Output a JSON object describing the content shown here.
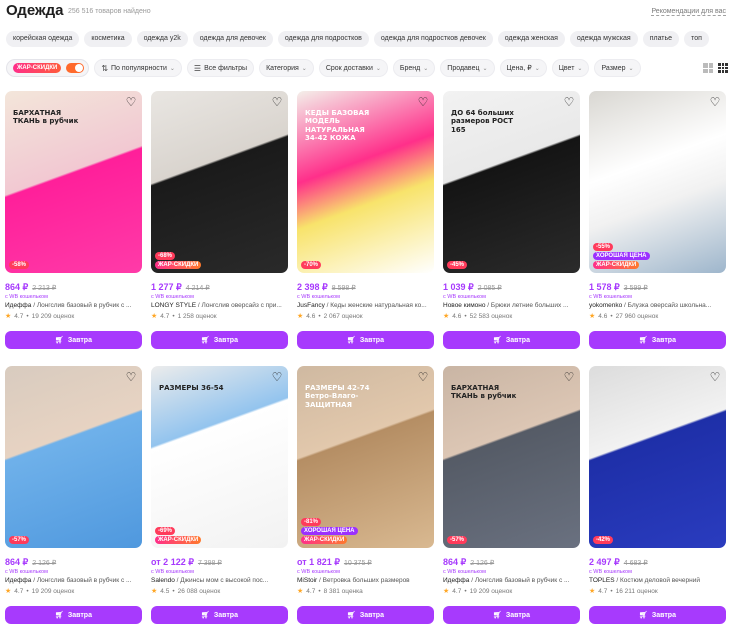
{
  "header": {
    "title": "Одежда",
    "count": "256 516 товаров найдено",
    "recs": "Рекомендации для вас"
  },
  "tags": [
    "корейская одежда",
    "косметика",
    "одежда y2k",
    "одежда для девочек",
    "одежда для подростков",
    "одежда для подростков девочек",
    "одежда женская",
    "одежда мужская",
    "платье",
    "топ"
  ],
  "filters": {
    "hot_label": "ЖАР-СКИДКИ",
    "sort": "По популярности",
    "all": "Все фильтры",
    "items": [
      "Категория",
      "Срок доставки",
      "Бренд",
      "Продавец",
      "Цена, ₽",
      "Цвет",
      "Размер"
    ]
  },
  "buy_label": "Завтра",
  "wallet_label": "с WB кошельком",
  "colors": {
    "accent": "#a73afd",
    "discount": "#ff3b5b",
    "hot": "#ff5b3a"
  },
  "products": [
    {
      "price": "864 ₽",
      "old": "2 213 ₽",
      "brand": "Идеффа",
      "title": "Лонгслив базовый в рубчик с ...",
      "rating": "4.7",
      "reviews": "19 209 оценок",
      "discount": "-58%",
      "good": "",
      "hot": "",
      "overlay": "БАРХАТНАЯ ТКАНЬ в рубчик"
    },
    {
      "price": "1 277 ₽",
      "old": "4 214 ₽",
      "brand": "LONGY STYLE",
      "title": "Лонгслив оверсайз с при...",
      "rating": "4.7",
      "reviews": "1 258 оценок",
      "discount": "-68%",
      "good": "",
      "hot": "ЖАР-СКИДКИ",
      "overlay": ""
    },
    {
      "price": "2 398 ₽",
      "old": "8 598 ₽",
      "brand": "JusFancy",
      "title": "Кеды женские натуральная ко...",
      "rating": "4.6",
      "reviews": "2 067 оценок",
      "discount": "-70%",
      "good": "",
      "hot": "",
      "overlay": "КЕДЫ БАЗОВАЯ МОДЕЛЬ НАТУРАЛЬНАЯ 34-42 КОЖА"
    },
    {
      "price": "1 039 ₽",
      "old": "2 085 ₽",
      "brand": "Новое кимоно",
      "title": "Брюки летние больших ...",
      "rating": "4.6",
      "reviews": "52 583 оценок",
      "discount": "-45%",
      "good": "",
      "hot": "",
      "overlay": "ДО 64 больших размеров РОСТ 165"
    },
    {
      "price": "1 578 ₽",
      "old": "3 599 ₽",
      "brand": "yokomenko",
      "title": "Блузка оверсайз школьна...",
      "rating": "4.6",
      "reviews": "27 960 оценок",
      "discount": "-55%",
      "good": "ХОРОШАЯ ЦЕНА",
      "hot": "ЖАР-СКИДКИ",
      "overlay": ""
    },
    {
      "price": "864 ₽",
      "old": "2 126 ₽",
      "brand": "Идеффа",
      "title": "Лонгслив базовый в рубчик с ...",
      "rating": "4.7",
      "reviews": "19 209 оценок",
      "discount": "-57%",
      "good": "",
      "hot": "",
      "overlay": ""
    },
    {
      "price": "от 2 122 ₽",
      "old": "7 398 ₽",
      "brand": "Salendo",
      "title": "Джинсы мом с высокой пос...",
      "rating": "4.5",
      "reviews": "26 088 оценок",
      "discount": "-69%",
      "good": "",
      "hot": "ЖАР-СКИДКИ",
      "overlay": "РАЗМЕРЫ 36-54"
    },
    {
      "price": "от 1 821 ₽",
      "old": "10 375 ₽",
      "brand": "MiStoir",
      "title": "Ветровка больших размеров",
      "rating": "4.7",
      "reviews": "8 381 оценка",
      "discount": "-81%",
      "good": "ХОРОШАЯ ЦЕНА",
      "hot": "ЖАР-СКИДКИ",
      "overlay": "РАЗМЕРЫ 42-74 Ветро-Влаго-ЗАЩИТНАЯ"
    },
    {
      "price": "864 ₽",
      "old": "2 126 ₽",
      "brand": "Идеффа",
      "title": "Лонгслив базовый в рубчик с ...",
      "rating": "4.7",
      "reviews": "19 209 оценок",
      "discount": "-57%",
      "good": "",
      "hot": "",
      "overlay": "БАРХАТНАЯ ТКАНЬ в рубчик"
    },
    {
      "price": "2 497 ₽",
      "old": "4 683 ₽",
      "brand": "TOPLES",
      "title": "Костюм деловой вечерний",
      "rating": "4.7",
      "reviews": "16 211 оценок",
      "discount": "-42%",
      "good": "",
      "hot": "",
      "overlay": ""
    }
  ]
}
